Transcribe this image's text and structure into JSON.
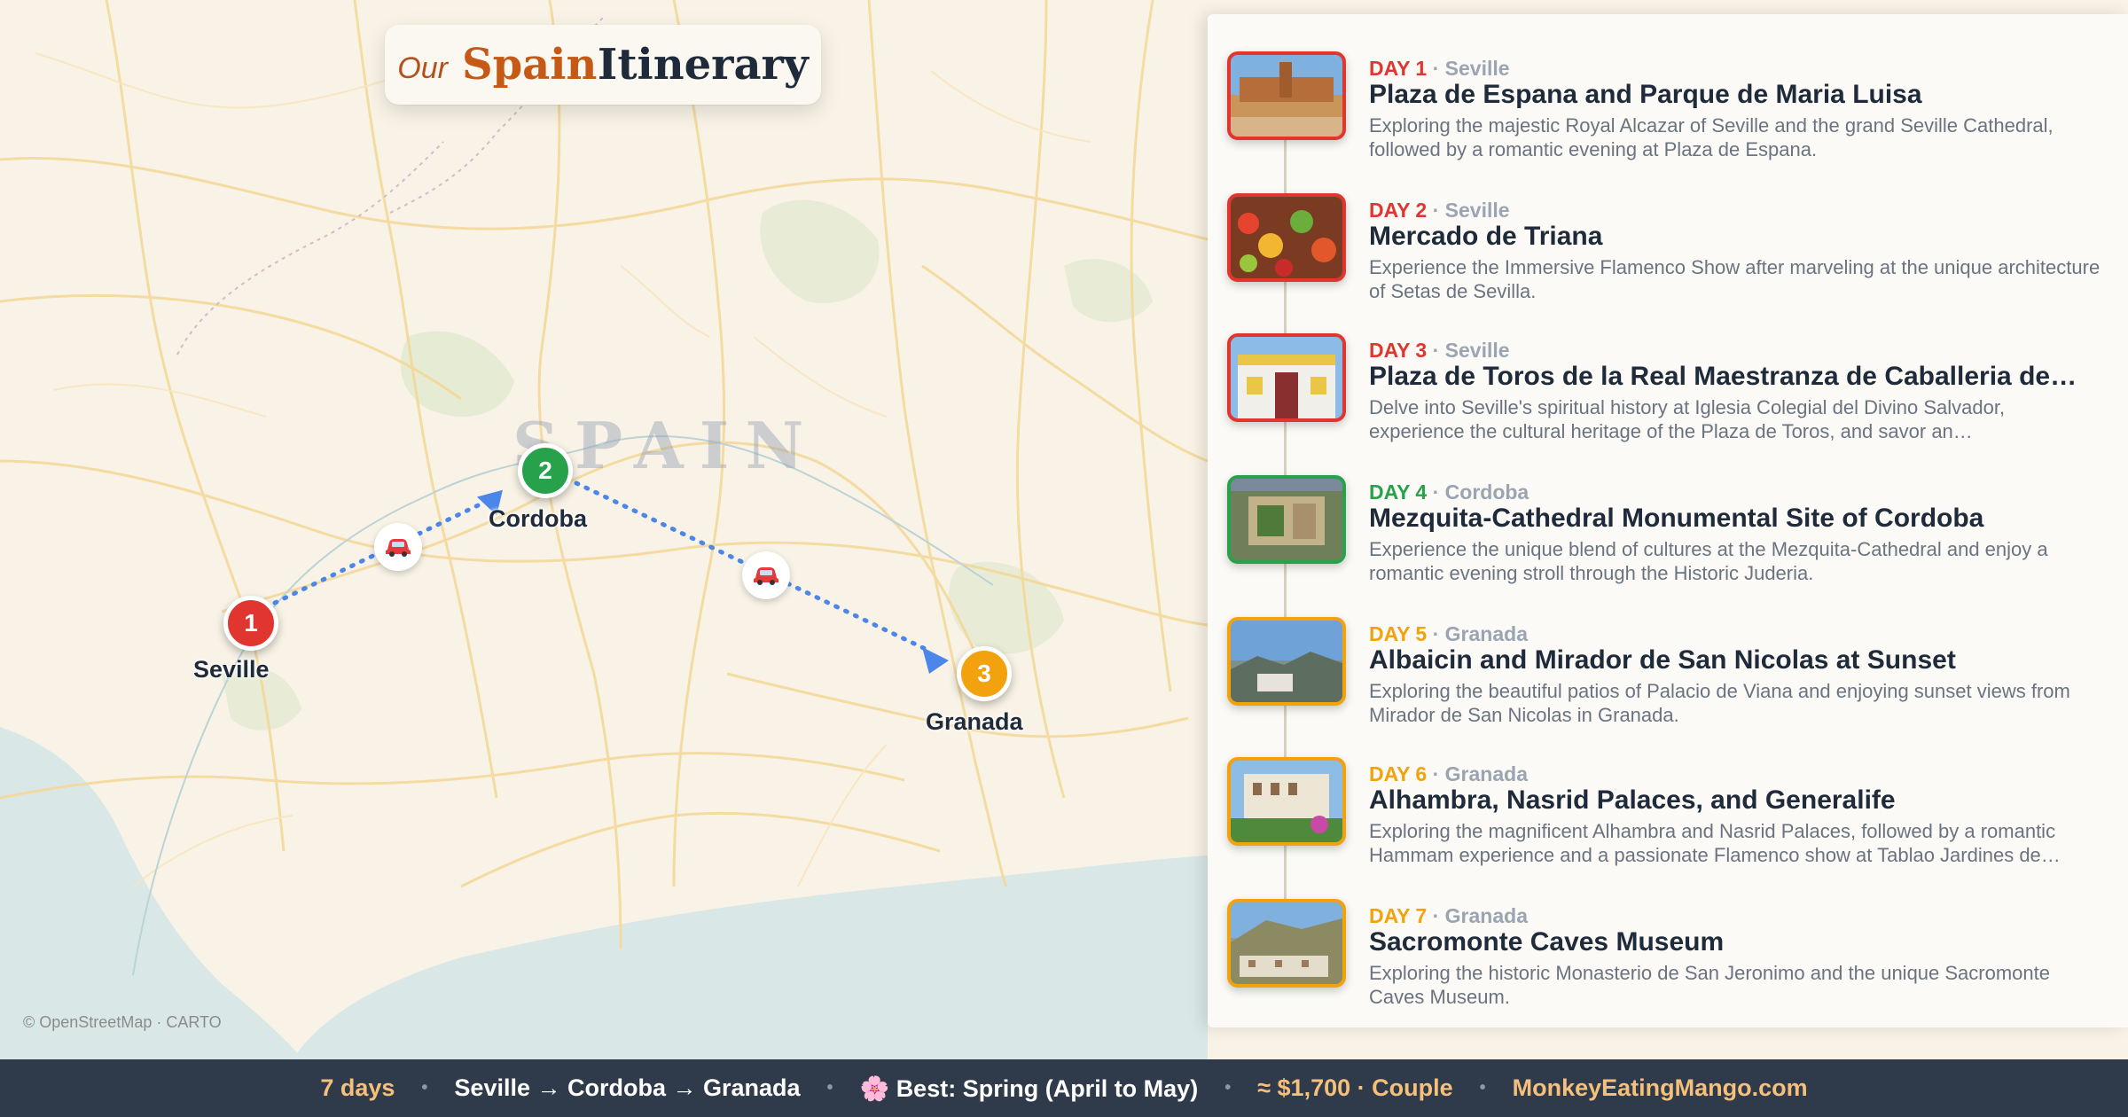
{
  "title": {
    "prefix": "Our",
    "highlight": "Spain",
    "rest": "Itinerary"
  },
  "map": {
    "country_label": "SPAIN",
    "attribution": "© OpenStreetMap · CARTO",
    "stops": [
      {
        "number": "1",
        "city": "Seville",
        "color": "#e0362f"
      },
      {
        "number": "2",
        "city": "Cordoba",
        "color": "#27a24a"
      },
      {
        "number": "3",
        "city": "Granada",
        "color": "#f2a20c"
      }
    ],
    "transport_icon": "car-icon",
    "route_color": "#4b86e8"
  },
  "itinerary": [
    {
      "day": "DAY 1",
      "city": "Seville",
      "color": "#e0362f",
      "title": "Plaza de Espana and Parque de Maria Luisa",
      "description": "Exploring the majestic Royal Alcazar of Seville and the grand Seville Cathedral, followed by a romantic evening at Plaza de Espana."
    },
    {
      "day": "DAY 2",
      "city": "Seville",
      "color": "#e0362f",
      "title": "Mercado de Triana",
      "description": "Experience the Immersive Flamenco Show after marveling at the unique architecture of Setas de Sevilla."
    },
    {
      "day": "DAY 3",
      "city": "Seville",
      "color": "#e0362f",
      "title": "Plaza de Toros de la Real Maestranza de Caballeria de…",
      "description": "Delve into Seville's spiritual history at Iglesia Colegial del Divino Salvador, experience the cultural heritage of the Plaza de Toros, and savor an…"
    },
    {
      "day": "DAY 4",
      "city": "Cordoba",
      "color": "#27a24a",
      "title": "Mezquita-Cathedral Monumental Site of Cordoba",
      "description": "Experience the unique blend of cultures at the Mezquita-Cathedral and enjoy a romantic evening stroll through the Historic Juderia."
    },
    {
      "day": "DAY 5",
      "city": "Granada",
      "color": "#f2a20c",
      "title": "Albaicin and Mirador de San Nicolas at Sunset",
      "description": "Exploring the beautiful patios of Palacio de Viana and enjoying sunset views from Mirador de San Nicolas in Granada."
    },
    {
      "day": "DAY 6",
      "city": "Granada",
      "color": "#f2a20c",
      "title": "Alhambra, Nasrid Palaces, and Generalife",
      "description": "Exploring the magnificent Alhambra and Nasrid Palaces, followed by a romantic Hammam experience and a passionate Flamenco show at Tablao Jardines de…"
    },
    {
      "day": "DAY 7",
      "city": "Granada",
      "color": "#f2a20c",
      "title": "Sacromonte Caves Museum",
      "description": "Exploring the historic Monasterio de San Jeronimo and the unique Sacromonte Caves Museum."
    }
  ],
  "footer": {
    "duration": "7 days",
    "route": "Seville → Cordoba → Granada",
    "season_icon": "🌸",
    "season": "Best: Spring (April to May)",
    "budget": "≈ $1,700 · Couple",
    "site": "MonkeyEatingMango.com",
    "separator": "•",
    "colors": {
      "duration": "#f6c07a",
      "route": "#ffffff",
      "season": "#ffffff",
      "budget": "#f6c07a",
      "site": "#f6c07a"
    }
  }
}
